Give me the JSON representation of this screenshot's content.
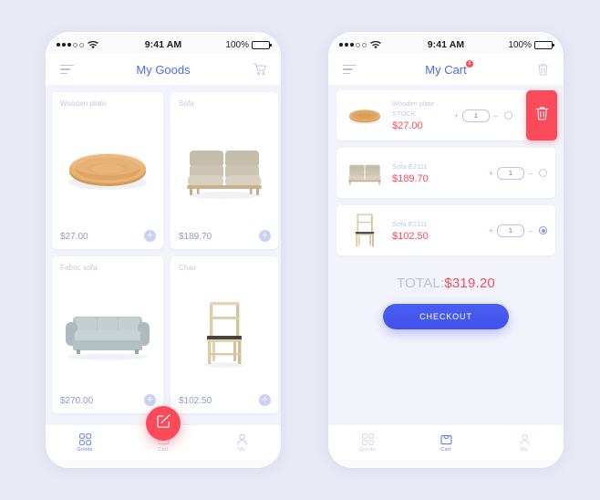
{
  "theme": {
    "page_bg": "#e7e9f5",
    "accent_red": "#fb4a59",
    "accent_blue": "#4a6cf7",
    "muted": "#c3c9e6"
  },
  "status_bar": {
    "time": "9:41 AM",
    "battery_percent": "100%",
    "signal_icon": "signal-dots-icon",
    "wifi_icon": "wifi-icon",
    "battery_icon": "battery-full-icon"
  },
  "goods_screen": {
    "nav": {
      "menu_icon": "hamburger-menu-icon",
      "title": "My Goods",
      "cart_icon": "shopping-cart-icon"
    },
    "products": [
      {
        "name": "Wooden plate",
        "price": "$27.00",
        "art": "wooden-plate",
        "add_icon": "plus-circle-icon"
      },
      {
        "name": "Sofa",
        "price": "$189.70",
        "art": "beige-sofa",
        "add_icon": "plus-circle-icon"
      },
      {
        "name": "Fabric sofa",
        "price": "$270.00",
        "art": "grey-sofa",
        "add_icon": "plus-circle-icon"
      },
      {
        "name": "Chair",
        "price": "$102.50",
        "art": "wood-chair",
        "add_icon": "plus-circle-icon"
      }
    ],
    "fab": {
      "icon": "compose-edit-icon"
    },
    "tabs": [
      {
        "label": "Goods",
        "icon": "grid-icon",
        "active": true
      },
      {
        "label": "Cart",
        "icon": "basket-icon",
        "active": false
      },
      {
        "label": "My",
        "icon": "person-icon",
        "active": false
      }
    ]
  },
  "cart_screen": {
    "nav": {
      "menu_icon": "hamburger-menu-icon",
      "title": "My Cart",
      "badge": "3",
      "trash_icon": "trash-icon"
    },
    "items": [
      {
        "name": "Wooden plate",
        "subtitle": "STOCK",
        "price": "$27.00",
        "qty": "1",
        "art": "wooden-plate",
        "selected": false,
        "swiped": true,
        "delete_icon": "trash-icon",
        "increase_label": "+",
        "decrease_label": "–"
      },
      {
        "name": "Sofa-E2111",
        "subtitle": "",
        "price": "$189.70",
        "qty": "1",
        "art": "beige-sofa",
        "selected": false,
        "swiped": false,
        "increase_label": "+",
        "decrease_label": "–"
      },
      {
        "name": "Sofa-E2111",
        "subtitle": "",
        "price": "$102.50",
        "qty": "1",
        "art": "wood-chair",
        "selected": true,
        "swiped": false,
        "increase_label": "+",
        "decrease_label": "–"
      }
    ],
    "total_label": "TOTAL:",
    "total_amount": "$319.20",
    "checkout_label": "CHECKOUT",
    "tabs": [
      {
        "label": "Goods",
        "icon": "grid-icon",
        "active": false
      },
      {
        "label": "Cart",
        "icon": "basket-icon",
        "active": true
      },
      {
        "label": "My",
        "icon": "person-icon",
        "active": false
      }
    ]
  }
}
